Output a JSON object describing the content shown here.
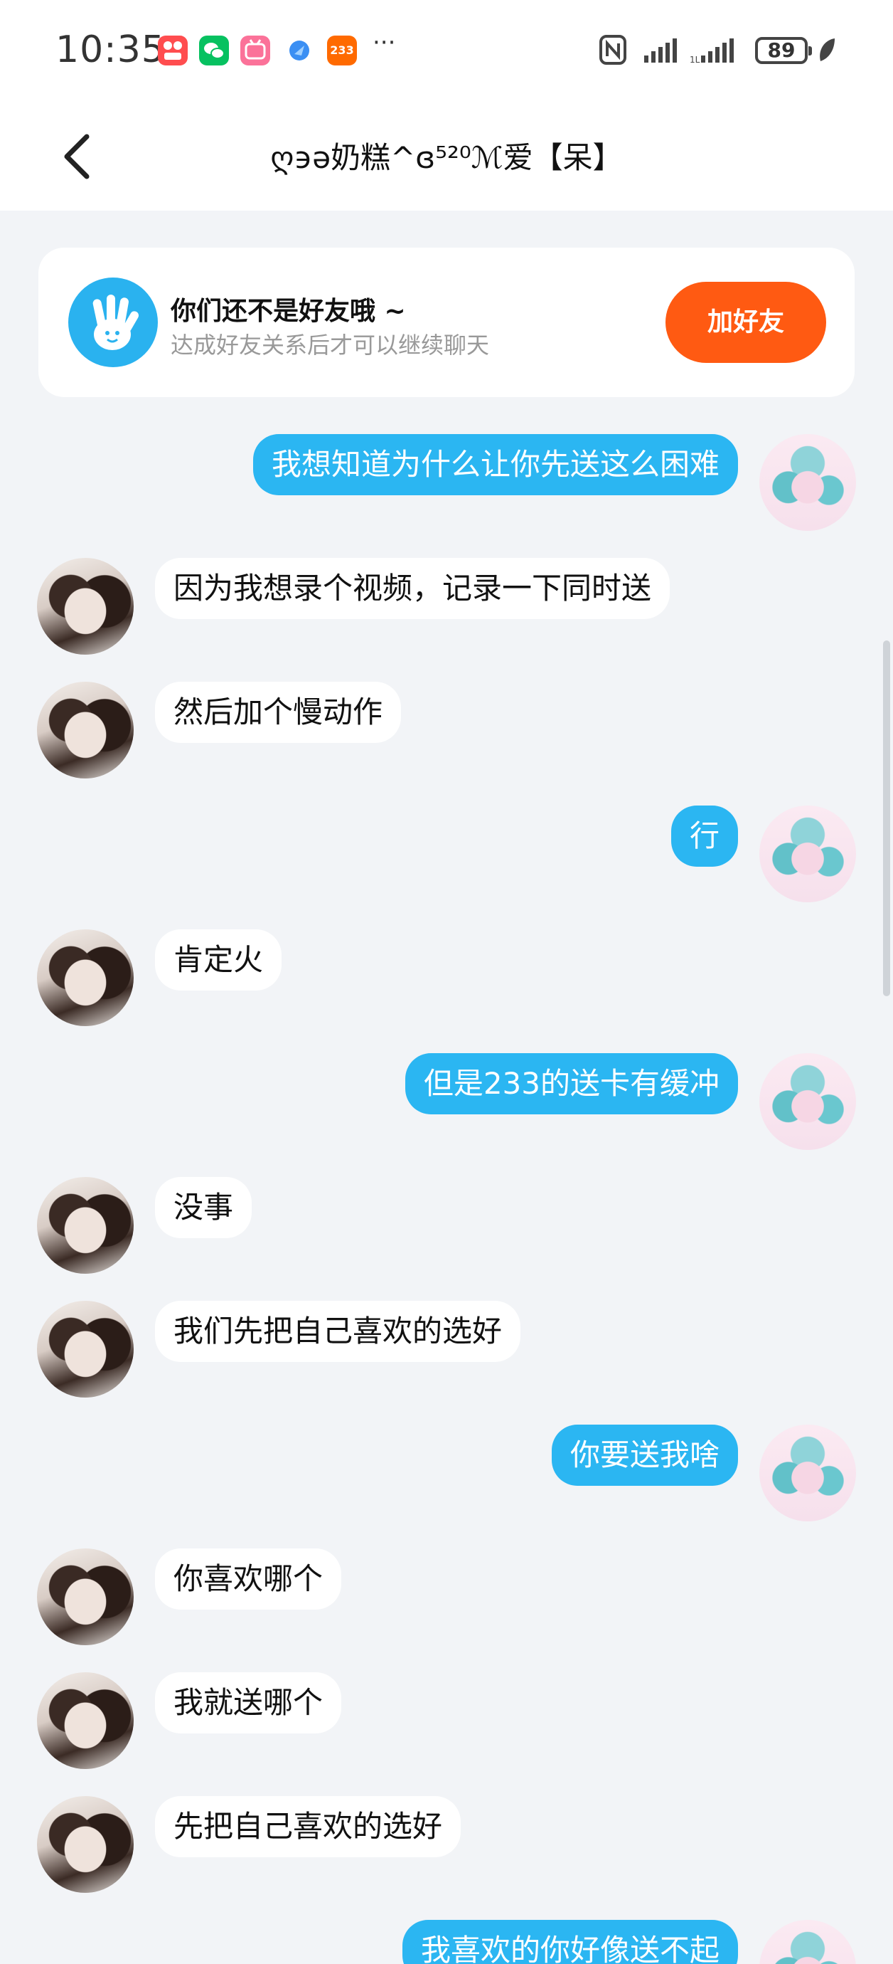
{
  "status_bar": {
    "time": "10:35",
    "battery": "89",
    "app_icons": [
      {
        "name": "red-video-app-icon",
        "color": "#ff4d4f"
      },
      {
        "name": "wechat-icon",
        "color": "#07c160"
      },
      {
        "name": "bilibili-icon",
        "color": "#fb7299"
      },
      {
        "name": "browser-app-icon",
        "color": "#3b8ff3"
      },
      {
        "name": "app-233-icon",
        "color": "#ff6a00"
      }
    ],
    "app_233_label": "233",
    "more": "···"
  },
  "header": {
    "title": "ღ϶ə奶糕^ɞ⁵²⁰ℳ爱【呆】"
  },
  "notice": {
    "title": "你们还不是好友哦 ~",
    "subtitle": "达成好友关系后才可以继续聊天",
    "add_button": "加好友"
  },
  "messages": [
    {
      "from": "me",
      "text": "我想知道为什么让你先送这么困难"
    },
    {
      "from": "other",
      "text": "因为我想录个视频，记录一下同时送"
    },
    {
      "from": "other",
      "text": "然后加个慢动作"
    },
    {
      "from": "me",
      "text": "行"
    },
    {
      "from": "other",
      "text": "肯定火"
    },
    {
      "from": "me",
      "text": "但是233的送卡有缓冲"
    },
    {
      "from": "other",
      "text": "没事"
    },
    {
      "from": "other",
      "text": "我们先把自己喜欢的选好"
    },
    {
      "from": "me",
      "text": "你要送我啥"
    },
    {
      "from": "other",
      "text": "你喜欢哪个"
    },
    {
      "from": "other",
      "text": "我就送哪个"
    },
    {
      "from": "other",
      "text": "先把自己喜欢的选好"
    },
    {
      "from": "me",
      "text": "我喜欢的你好像送不起"
    }
  ],
  "colors": {
    "accent_blue": "#2bb6f2",
    "add_orange": "#ff5a12",
    "background": "#f2f4f7"
  }
}
